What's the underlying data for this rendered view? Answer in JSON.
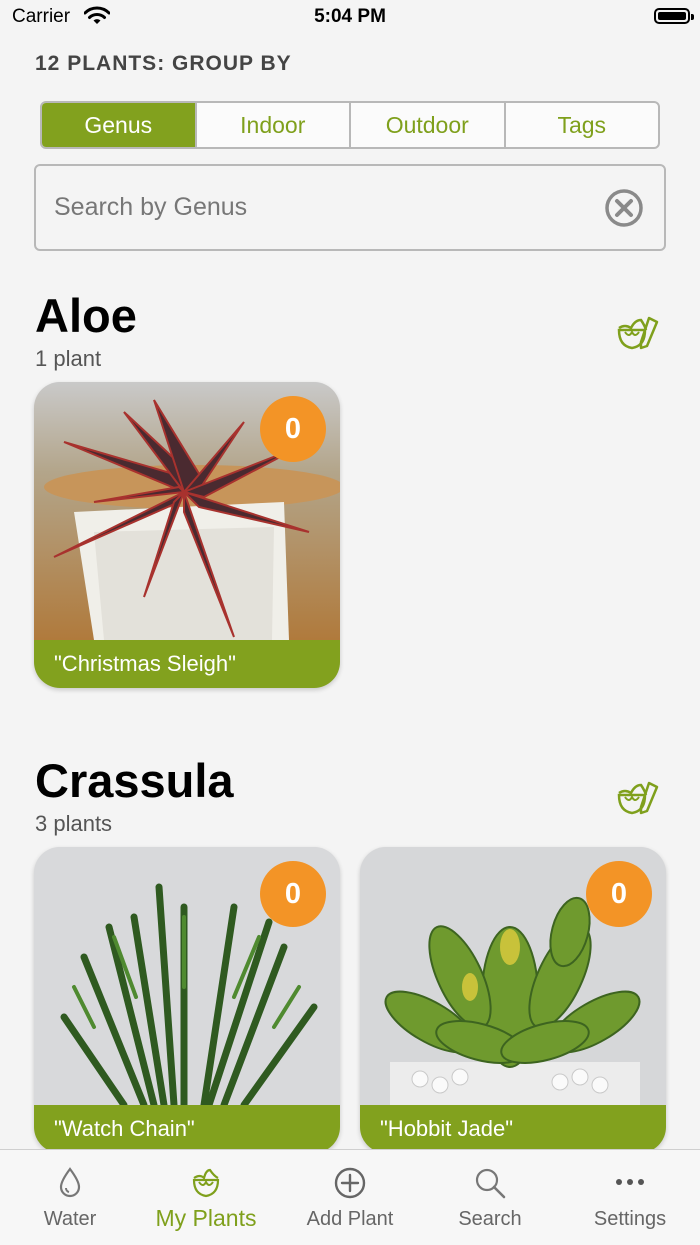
{
  "status": {
    "carrier": "Carrier",
    "time": "5:04 PM"
  },
  "header": {
    "group_label": "12 PLANTS: GROUP BY"
  },
  "segments": [
    "Genus",
    "Indoor",
    "Outdoor",
    "Tags"
  ],
  "active_segment": "Genus",
  "search": {
    "placeholder": "Search by Genus",
    "value": ""
  },
  "sections": [
    {
      "title": "Aloe",
      "count": "1 plant",
      "plants": [
        {
          "name": "\"Christmas Sleigh\"",
          "badge": "0"
        }
      ]
    },
    {
      "title": "Crassula",
      "count": "3 plants",
      "plants": [
        {
          "name": "\"Watch Chain\"",
          "badge": "0"
        },
        {
          "name": "\"Hobbit Jade\"",
          "badge": "0"
        }
      ]
    }
  ],
  "tabbar": [
    {
      "label": "Water",
      "icon": "water-drop-icon"
    },
    {
      "label": "My Plants",
      "icon": "plant-icon",
      "active": true
    },
    {
      "label": "Add Plant",
      "icon": "add-circle-icon"
    },
    {
      "label": "Search",
      "icon": "search-icon"
    },
    {
      "label": "Settings",
      "icon": "more-dots-icon"
    }
  ],
  "colors": {
    "accent": "#82a11e",
    "badge": "#f39426",
    "background": "#f4f4f4"
  }
}
